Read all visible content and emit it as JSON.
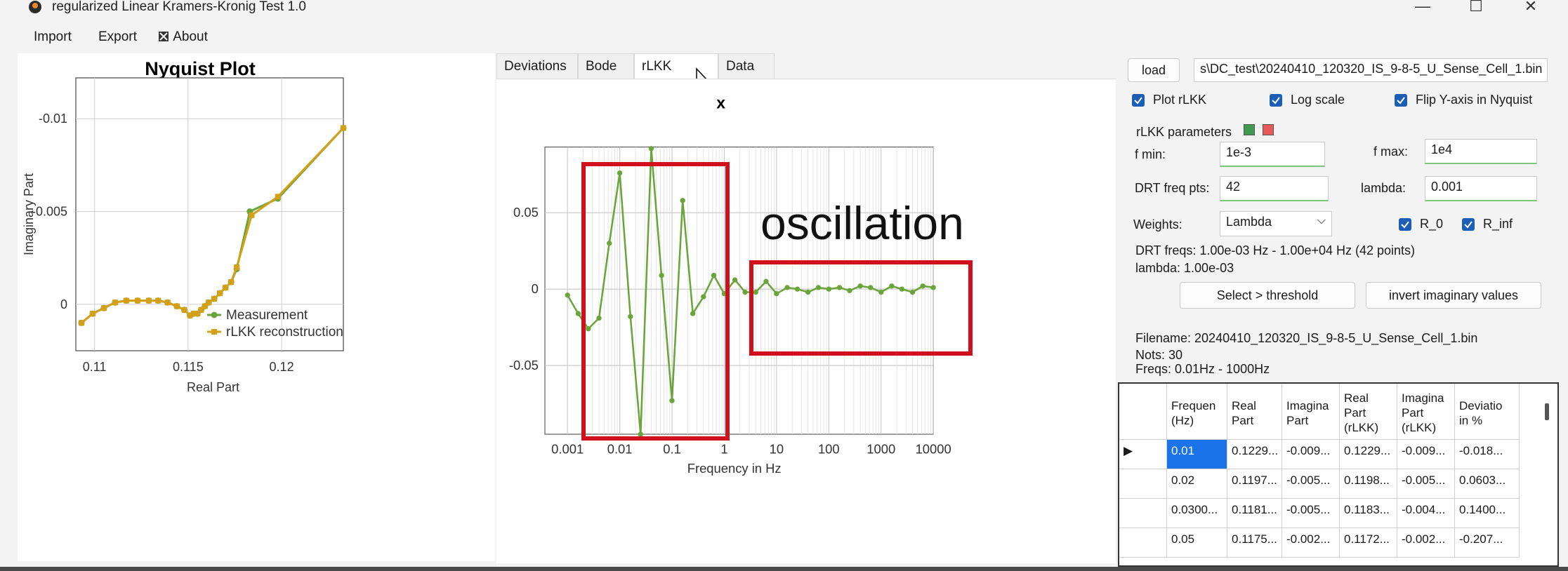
{
  "window": {
    "title": "regularized Linear Kramers-Kronig Test 1.0"
  },
  "menu": {
    "import": "Import",
    "export": "Export",
    "about": "About"
  },
  "nyquist": {
    "chart_data": {
      "type": "line",
      "title": "Nyquist Plot",
      "xlabel": "Real Part",
      "ylabel": "Imaginary Part",
      "xlim": [
        0.109,
        0.1233
      ],
      "ylim": [
        0.0025,
        -0.0122
      ],
      "y_inverted": true,
      "x_ticks": [
        0.11,
        0.115,
        0.12
      ],
      "x_tick_labels": [
        "0.11",
        "0.115",
        "0.12"
      ],
      "y_ticks": [
        -0.01,
        -0.005,
        0
      ],
      "y_tick_labels": [
        "-0.01",
        "-0.005",
        "0"
      ],
      "grid": true,
      "legend_position": "bottom-right",
      "series": [
        {
          "name": "Measurement",
          "color": "#6aa43a",
          "x": [
            0.1093,
            0.1099,
            0.1105,
            0.1111,
            0.1117,
            0.1123,
            0.1129,
            0.1134,
            0.1139,
            0.1144,
            0.1148,
            0.1151,
            0.1153,
            0.1155,
            0.1157,
            0.1159,
            0.1161,
            0.1164,
            0.1167,
            0.117,
            0.1173,
            0.1176,
            0.1183,
            0.1198,
            0.1233
          ],
          "y": [
            0.001,
            0.0005,
            0.0002,
            -0.0001,
            -0.0002,
            -0.0002,
            -0.0002,
            -0.0002,
            -0.0001,
            0.0001,
            0.0003,
            0.0006,
            0.0005,
            0.0005,
            0.0003,
            0.0001,
            -0.0001,
            -0.0003,
            -0.0006,
            -0.0009,
            -0.0012,
            -0.0019,
            -0.005,
            -0.0057,
            -0.0095
          ]
        },
        {
          "name": "rLKK reconstruction",
          "color": "#d4a017",
          "x": [
            0.1093,
            0.1099,
            0.1105,
            0.1111,
            0.1117,
            0.1123,
            0.1129,
            0.1134,
            0.1139,
            0.1144,
            0.1148,
            0.1151,
            0.1153,
            0.1155,
            0.1157,
            0.1159,
            0.1161,
            0.1164,
            0.1167,
            0.117,
            0.1173,
            0.1176,
            0.1184,
            0.1198,
            0.1233
          ],
          "y": [
            0.001,
            0.0005,
            0.0002,
            -0.0001,
            -0.0002,
            -0.0002,
            -0.0002,
            -0.0002,
            -0.0001,
            0.0001,
            0.0003,
            0.0006,
            0.0005,
            0.0005,
            0.0003,
            0.0001,
            -0.0001,
            -0.0003,
            -0.0006,
            -0.0009,
            -0.0012,
            -0.002,
            -0.0048,
            -0.0058,
            -0.0095
          ]
        }
      ]
    }
  },
  "tabs": [
    "Deviations",
    "Bode",
    "rLKK results",
    "Data"
  ],
  "freqplot": {
    "chart_data": {
      "type": "line",
      "title": "x",
      "xlabel": "Frequency in Hz",
      "ylabel": "",
      "x_log": true,
      "xlim": [
        0.001,
        10000
      ],
      "ylim": [
        -0.095,
        0.093
      ],
      "x_ticks": [
        0.001,
        0.01,
        0.1,
        1,
        10,
        100,
        1000,
        10000
      ],
      "x_tick_labels": [
        "0.001",
        "0.01",
        "0.1",
        "1",
        "10",
        "100",
        "1000",
        "10000"
      ],
      "y_ticks": [
        0.05,
        0,
        -0.05
      ],
      "y_tick_labels": [
        "0.05",
        "0",
        "-0.05"
      ],
      "grid": true,
      "series": [
        {
          "color": "#6aa43a",
          "x": [
            0.001,
            0.0016,
            0.0025,
            0.004,
            0.0063,
            0.01,
            0.016,
            0.025,
            0.04,
            0.063,
            0.1,
            0.16,
            0.25,
            0.4,
            0.63,
            1,
            1.6,
            2.5,
            4,
            6.3,
            10,
            16,
            25,
            40,
            63,
            100,
            160,
            250,
            400,
            630,
            1000,
            1600,
            2500,
            4000,
            6300,
            10000
          ],
          "y": [
            -0.004,
            -0.016,
            -0.026,
            -0.019,
            0.03,
            0.076,
            -0.018,
            -0.095,
            0.092,
            0.009,
            -0.073,
            0.058,
            -0.016,
            -0.005,
            0.009,
            -0.003,
            0.006,
            -0.002,
            -0.002,
            0.005,
            -0.003,
            0.001,
            0.0,
            -0.002,
            0.001,
            0.0,
            0.001,
            -0.001,
            0.002,
            0.001,
            -0.002,
            0.002,
            0.0,
            -0.002,
            0.002,
            0.001
          ]
        }
      ]
    },
    "annotation": "oscillation"
  },
  "controls": {
    "load_label": "load",
    "filepath": "s\\DC_test\\20240410_120320_IS_9-8-5_U_Sense_Cell_1.bin",
    "plot_rlkk": "Plot rLKK",
    "log_scale": "Log scale",
    "flip_y": "Flip Y-axis in Nyquist",
    "params_title": "rLKK parameters",
    "f_min_label": "f min:",
    "f_min_value": "1e-3",
    "f_max_label": "f max:",
    "f_max_value": "1e4",
    "drt_pts_label": "DRT freq pts:",
    "drt_pts_value": "42",
    "lambda_label": "lambda:",
    "lambda_value": "0.001",
    "weights_label": "Weights:",
    "weights_value": "Lambda",
    "r0_label": "R_0",
    "rinf_label": "R_inf",
    "drt_freqs_text": "DRT freqs:  1.00e-03 Hz  -  1.00e+04 Hz (42 points)",
    "lambda_text": "lambda: 1.00e-03",
    "select_threshold": "Select > threshold",
    "invert_imag": "invert imaginary values",
    "filename_text": "Filename: 20240410_120320_IS_9-8-5_U_Sense_Cell_1.bin",
    "nots_text": "Nots: 30",
    "freqs_text": "Freqs: 0.01Hz - 1000Hz"
  },
  "table": {
    "headers": [
      "Frequen\n(Hz)",
      "Real\nPart",
      "Imagina\nPart",
      "Real\nPart\n(rLKK)",
      "Imagina\nPart\n(rLKK)",
      "Deviatio\nin %"
    ],
    "rows": [
      [
        "0.01",
        "0.1229...",
        "-0.009...",
        "0.1229...",
        "-0.009...",
        "-0.018..."
      ],
      [
        "0.02",
        "0.1197...",
        "-0.005...",
        "0.1198...",
        "-0.005...",
        "0.0603..."
      ],
      [
        "0.0300...",
        "0.1181...",
        "-0.005...",
        "0.1183...",
        "-0.004...",
        "0.1400..."
      ],
      [
        "0.05",
        "0.1175...",
        "-0.002...",
        "0.1172...",
        "-0.002...",
        "-0.207..."
      ]
    ],
    "row_marker": "▶"
  }
}
